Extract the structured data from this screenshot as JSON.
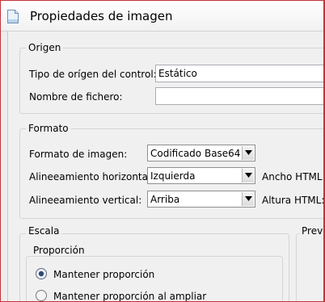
{
  "window": {
    "title": "Propiedades de imagen",
    "icon": "document-icon"
  },
  "origen": {
    "title": "Origen",
    "tipo_label": "Tipo de orígen del control:",
    "tipo_value": "Estático",
    "nombre_label": "Nombre de fichero:",
    "nombre_value": ""
  },
  "formato": {
    "title": "Formato",
    "formato_label": "Formato de imagen:",
    "formato_value": "Codificado Base64",
    "halign_label": "Alineeamiento horizontal:",
    "halign_value": "Izquierda",
    "ancho_label": "Ancho HTML:",
    "valign_label": "Alineeamiento vertical:",
    "valign_value": "Arriba",
    "altura_label": "Altura HTML:"
  },
  "escala": {
    "title": "Escala",
    "proporcion_title": "Proporción",
    "options": [
      {
        "label": "Mantener proporción",
        "selected": true
      },
      {
        "label": "Mantener proporción al ampliar",
        "selected": false
      }
    ]
  },
  "preview": {
    "title": "Previ"
  }
}
